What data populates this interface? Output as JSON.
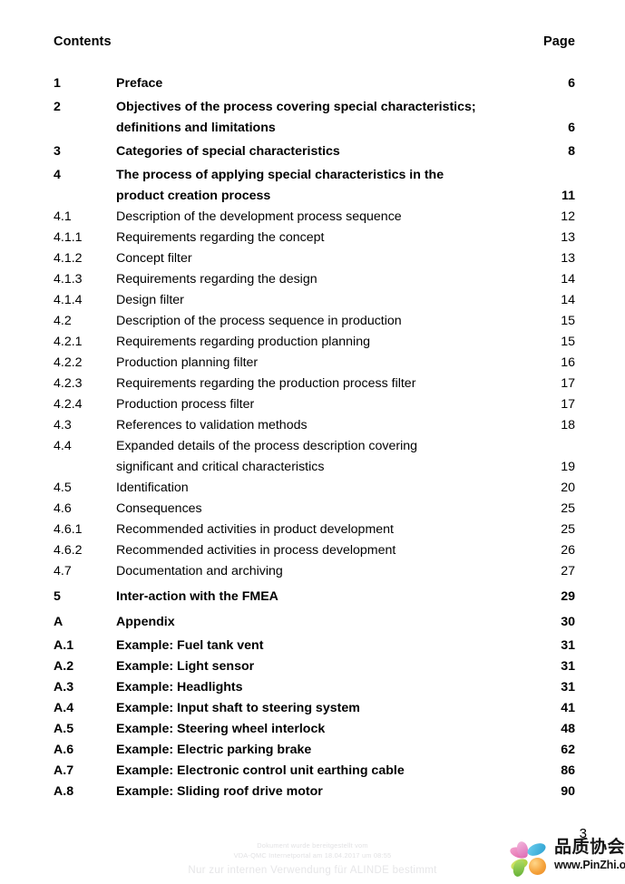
{
  "document": {
    "header": {
      "contents_label": "Contents",
      "page_label": "Page"
    },
    "folio": "3",
    "entries": [
      {
        "num": "1",
        "title": "Preface",
        "title2": "",
        "page": "6",
        "level": "level1",
        "spacing": "gap-top"
      },
      {
        "num": "2",
        "title": "Objectives of the process covering special characteristics;",
        "title2": "definitions and limitations",
        "page": "6",
        "level": "level1",
        "spacing": "gap-top"
      },
      {
        "num": "3",
        "title": "Categories of special characteristics",
        "title2": "",
        "page": "8",
        "level": "level1",
        "spacing": "gap-top"
      },
      {
        "num": "4",
        "title": "The process of applying special characteristics in the",
        "title2": "product creation process",
        "page": "11",
        "level": "level1",
        "spacing": "gap-top"
      },
      {
        "num": "4.1",
        "title": "Description of the development process sequence",
        "title2": "",
        "page": "12",
        "level": "level2",
        "spacing": ""
      },
      {
        "num": "4.1.1",
        "title": "Requirements regarding the concept",
        "title2": "",
        "page": "13",
        "level": "level2",
        "spacing": ""
      },
      {
        "num": "4.1.2",
        "title": "Concept filter",
        "title2": "",
        "page": "13",
        "level": "level2",
        "spacing": ""
      },
      {
        "num": "4.1.3",
        "title": "Requirements regarding the design",
        "title2": "",
        "page": "14",
        "level": "level2",
        "spacing": ""
      },
      {
        "num": "4.1.4",
        "title": "Design filter",
        "title2": "",
        "page": "14",
        "level": "level2",
        "spacing": ""
      },
      {
        "num": "4.2",
        "title": "Description of the process sequence in production",
        "title2": "",
        "page": "15",
        "level": "level2",
        "spacing": ""
      },
      {
        "num": "4.2.1",
        "title": "Requirements regarding production planning",
        "title2": "",
        "page": "15",
        "level": "level2",
        "spacing": ""
      },
      {
        "num": "4.2.2",
        "title": "Production planning filter",
        "title2": "",
        "page": "16",
        "level": "level2",
        "spacing": ""
      },
      {
        "num": "4.2.3",
        "title": "Requirements regarding the production process filter",
        "title2": "",
        "page": "17",
        "level": "level2",
        "spacing": ""
      },
      {
        "num": "4.2.4",
        "title": "Production process filter",
        "title2": "",
        "page": "17",
        "level": "level2",
        "spacing": ""
      },
      {
        "num": "4.3",
        "title": "References to validation methods",
        "title2": "",
        "page": "18",
        "level": "level2",
        "spacing": ""
      },
      {
        "num": "4.4",
        "title": "Expanded details of the process description covering",
        "title2": "significant and critical characteristics",
        "page": "19",
        "level": "level2",
        "spacing": ""
      },
      {
        "num": "4.5",
        "title": "Identification",
        "title2": "",
        "page": "20",
        "level": "level2",
        "spacing": ""
      },
      {
        "num": "4.6",
        "title": "Consequences",
        "title2": "",
        "page": "25",
        "level": "level2",
        "spacing": ""
      },
      {
        "num": "4.6.1",
        "title": "Recommended activities in product development",
        "title2": "",
        "page": "25",
        "level": "level2",
        "spacing": ""
      },
      {
        "num": "4.6.2",
        "title": "Recommended activities in process development",
        "title2": "",
        "page": "26",
        "level": "level2",
        "spacing": ""
      },
      {
        "num": "4.7",
        "title": "Documentation and archiving",
        "title2": "",
        "page": "27",
        "level": "level2",
        "spacing": ""
      },
      {
        "num": "5",
        "title": "Inter-action with the FMEA",
        "title2": "",
        "page": "29",
        "level": "level1",
        "spacing": "gap-top-lg"
      },
      {
        "num": "A",
        "title": "Appendix",
        "title2": "",
        "page": "30",
        "level": "appendix",
        "spacing": "gap-top-lg"
      },
      {
        "num": "A.1",
        "title": "Example:  Fuel tank vent",
        "title2": "",
        "page": "31",
        "level": "appendix",
        "spacing": "gap-top"
      },
      {
        "num": "A.2",
        "title": "Example: Light sensor",
        "title2": "",
        "page": "31",
        "level": "appendix",
        "spacing": ""
      },
      {
        "num": "A.3",
        "title": "Example: Headlights",
        "title2": "",
        "page": "31",
        "level": "appendix",
        "spacing": ""
      },
      {
        "num": "A.4",
        "title": "Example: Input shaft to steering system",
        "title2": "",
        "page": "41",
        "level": "appendix",
        "spacing": ""
      },
      {
        "num": "A.5",
        "title": "Example: Steering wheel interlock",
        "title2": "",
        "page": "48",
        "level": "appendix",
        "spacing": ""
      },
      {
        "num": "A.6",
        "title": "Example: Electric parking brake",
        "title2": "",
        "page": "62",
        "level": "appendix",
        "spacing": ""
      },
      {
        "num": "A.7",
        "title": "Example: Electronic control unit earthing cable",
        "title2": "",
        "page": "86",
        "level": "appendix",
        "spacing": ""
      },
      {
        "num": "A.8",
        "title": "Example: Sliding roof drive motor",
        "title2": "",
        "page": "90",
        "level": "appendix",
        "spacing": ""
      }
    ],
    "watermark": {
      "line1": "Dokument wurde bereitgestellt vom",
      "line2": "VDA-QMC Internetportal am 18.04.2017 um 08:55",
      "line3": "Nur zur internen Verwendung für ALINDE bestimmt"
    },
    "logo": {
      "chinese_name": "品质协会",
      "url": "www.PinZhi.org",
      "colors": {
        "cyan": "#2a9fd0",
        "pink": "#e060a8",
        "green": "#5fae33",
        "yellow": "#9ec93a",
        "orange": "#f5a33c"
      }
    }
  }
}
